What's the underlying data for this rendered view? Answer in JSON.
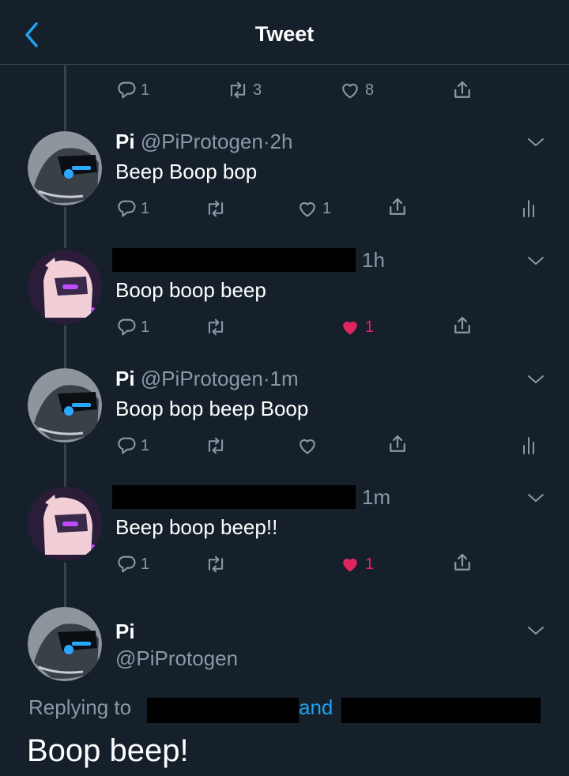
{
  "header": {
    "title": "Tweet"
  },
  "top_actions": {
    "replies": "1",
    "retweets": "3",
    "likes": "8"
  },
  "tweets": [
    {
      "name": "Pi",
      "handle": "@PiProtogen",
      "sep": "·",
      "time": "2h",
      "text": "Beep Boop bop",
      "replies": "1",
      "retweets": "",
      "likes": "1",
      "liked": false,
      "analytics": true
    },
    {
      "name": "",
      "handle": "",
      "sep": "",
      "time": "1h",
      "text": "Boop boop beep",
      "replies": "1",
      "retweets": "",
      "likes": "1",
      "liked": true,
      "analytics": false
    },
    {
      "name": "Pi",
      "handle": "@PiProtogen",
      "sep": "·",
      "time": "1m",
      "text": "Boop bop beep Boop",
      "replies": "1",
      "retweets": "",
      "likes": "",
      "liked": false,
      "analytics": true
    },
    {
      "name": "",
      "handle": "",
      "sep": "",
      "time": "1m",
      "text": "Beep boop beep!!",
      "replies": "1",
      "retweets": "",
      "likes": "1",
      "liked": true,
      "analytics": false
    }
  ],
  "main_tweet": {
    "name": "Pi",
    "handle": "@PiProtogen",
    "replying_to": "Replying to",
    "and": "and",
    "text": "Boop beep!"
  },
  "colors": {
    "background": "#15202b",
    "accent": "#1da1f2",
    "muted": "#8899a6",
    "like": "#e0245e",
    "divider": "#38444d"
  },
  "icons": [
    "back-chevron-icon",
    "reply-icon",
    "retweet-icon",
    "heart-icon",
    "share-icon",
    "analytics-icon",
    "chevron-down-icon"
  ]
}
